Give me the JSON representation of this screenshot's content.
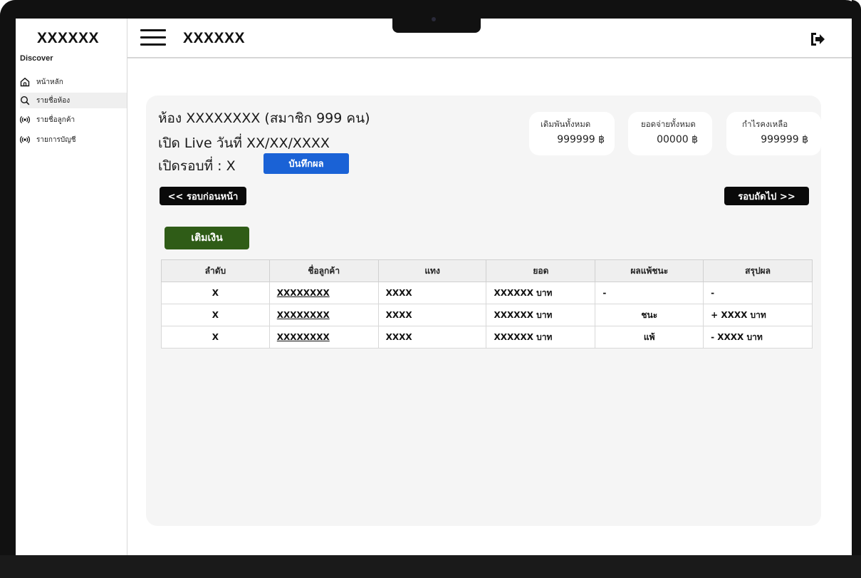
{
  "app": {
    "brand": "XXXXXX",
    "header_title": "XXXXXX"
  },
  "sidebar": {
    "section_label": "Discover",
    "items": [
      {
        "label": "หน้าหลัก",
        "icon": "home-icon"
      },
      {
        "label": "รายชื่อห้อง",
        "icon": "search-icon"
      },
      {
        "label": "รายชื่อลูกค้า",
        "icon": "broadcast-icon"
      },
      {
        "label": "รายการบัญชี",
        "icon": "broadcast-icon"
      }
    ],
    "active_index": 1
  },
  "room": {
    "title": "ห้อง XXXXXXXX  (สมาชิก 999 คน)",
    "live_date": "เปิด Live วันที่ XX/XX/XXXX",
    "round_label": "เปิดรอบที่  : X",
    "save_button": "บันทึกผล"
  },
  "stats": [
    {
      "label": "เดิมพันทั้งหมด",
      "value": "999999 ฿"
    },
    {
      "label": "ยอดจ่ายทั้งหมด",
      "value": "00000 ฿"
    },
    {
      "label": "กำไรคงเหลือ",
      "value": "999999 ฿"
    }
  ],
  "nav": {
    "prev_label": "<< รอบก่อนหน้า",
    "next_label": "รอบถัดไป >>"
  },
  "topup_button": "เติมเงิน",
  "table": {
    "headers": [
      "ลำดับ",
      "ชื่อลูกค้า",
      "แทง",
      "ยอด",
      "ผลแพ้ชนะ",
      "สรุปผล"
    ],
    "rows": [
      {
        "index": "X",
        "customer": "XXXXXXXX",
        "bet": "XXXX",
        "amount": "XXXXXX บาท",
        "result": "-",
        "summary": "-"
      },
      {
        "index": "X",
        "customer": "XXXXXXXX",
        "bet": "XXXX",
        "amount": "XXXXXX บาท",
        "result": "ชนะ",
        "summary": "+ XXXX บาท"
      },
      {
        "index": "X",
        "customer": "XXXXXXXX",
        "bet": "XXXX",
        "amount": "XXXXXX บาท",
        "result": "แพ้",
        "summary": "- XXXX บาท"
      }
    ]
  },
  "colors": {
    "save_button": "#1a62d6",
    "topup_button": "#2f5c17",
    "nav_button": "#0a0a0a",
    "card_bg": "#f5f5f5"
  }
}
